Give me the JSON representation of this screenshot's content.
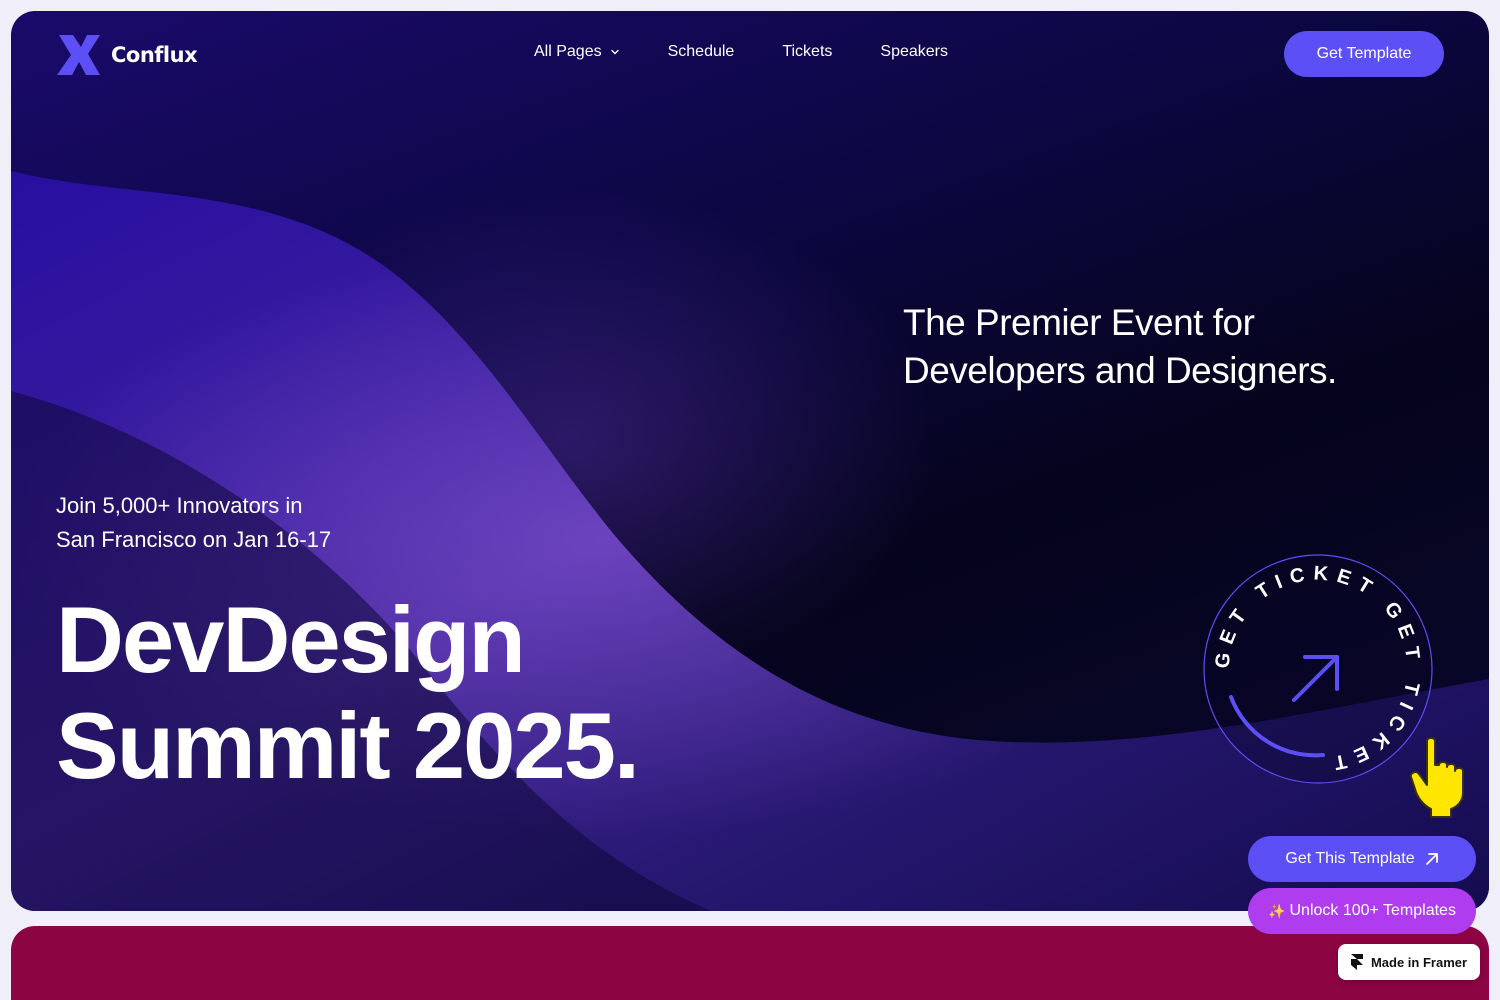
{
  "brand": {
    "name": "Conflux",
    "logo_icon": "conflux-x-logo-icon",
    "logo_color": "#5b4ff5"
  },
  "nav": {
    "items": [
      {
        "label": "All Pages",
        "icon": "chevron-down-icon"
      },
      {
        "label": "Schedule"
      },
      {
        "label": "Tickets"
      },
      {
        "label": "Speakers"
      }
    ],
    "cta_label": "Get Template"
  },
  "hero": {
    "tagline_lines": [
      "The Premier Event for",
      "Developers and Designers."
    ],
    "join_lines": [
      "Join 5,000+ Innovators in",
      "San Francisco on Jan 16-17"
    ],
    "title_lines": [
      "DevDesign",
      "Summit 2025."
    ],
    "ticket_badge": {
      "ring_text": "GET TICKET GET TICKET",
      "icon": "arrow-up-right-icon"
    }
  },
  "floating": {
    "get_this_template": "Get This Template",
    "unlock_templates": "Unlock 100+ Templates",
    "sparkle": "✨",
    "made_in_framer": "Made in Framer"
  },
  "colors": {
    "accent": "#5b4ff5",
    "purple_button": "#b03cf0",
    "section_two": "#8c0442",
    "pointer": "#ffe600"
  }
}
